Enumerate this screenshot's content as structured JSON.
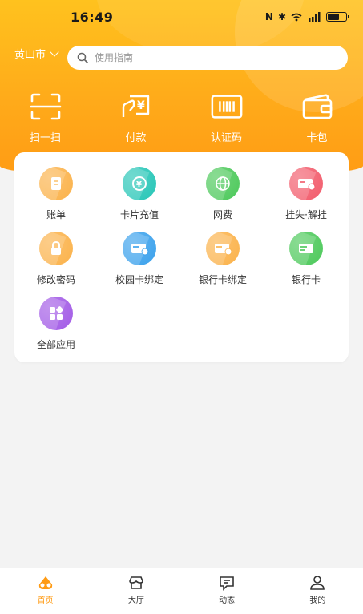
{
  "status_bar": {
    "time": "16:49",
    "battery_level": 0.6
  },
  "location": {
    "city": "黄山市"
  },
  "search": {
    "placeholder": "使用指南"
  },
  "quick_actions": [
    {
      "label": "扫一扫",
      "icon": "scan-icon"
    },
    {
      "label": "付款",
      "icon": "payment-icon"
    },
    {
      "label": "认证码",
      "icon": "auth-code-icon"
    },
    {
      "label": "卡包",
      "icon": "wallet-icon"
    }
  ],
  "services": [
    {
      "label": "账单",
      "icon": "bill-icon",
      "color": "#fbb24a"
    },
    {
      "label": "卡片充值",
      "icon": "recharge-icon",
      "color": "#26c6b7"
    },
    {
      "label": "网费",
      "icon": "globe-icon",
      "color": "#4cc95a"
    },
    {
      "label": "挂失·解挂",
      "icon": "card-lock-icon",
      "color": "#f25b6b"
    },
    {
      "label": "修改密码",
      "icon": "lock-icon",
      "color": "#fbb24a"
    },
    {
      "label": "校园卡绑定",
      "icon": "campus-card-icon",
      "color": "#3aa1ec"
    },
    {
      "label": "银行卡绑定",
      "icon": "bank-card-bind-icon",
      "color": "#fbb24a"
    },
    {
      "label": "银行卡",
      "icon": "bank-card-icon",
      "color": "#4cc95a"
    },
    {
      "label": "全部应用",
      "icon": "apps-icon",
      "color": "#a25ae6"
    }
  ],
  "tabs": [
    {
      "label": "首页",
      "icon": "home-icon",
      "active": true
    },
    {
      "label": "大厅",
      "icon": "hall-icon",
      "active": false
    },
    {
      "label": "动态",
      "icon": "message-icon",
      "active": false
    },
    {
      "label": "我的",
      "icon": "profile-icon",
      "active": false
    }
  ],
  "colors": {
    "accent": "#ff9b14",
    "header_top": "#ffc21e",
    "header_bottom": "#ff9b14"
  }
}
